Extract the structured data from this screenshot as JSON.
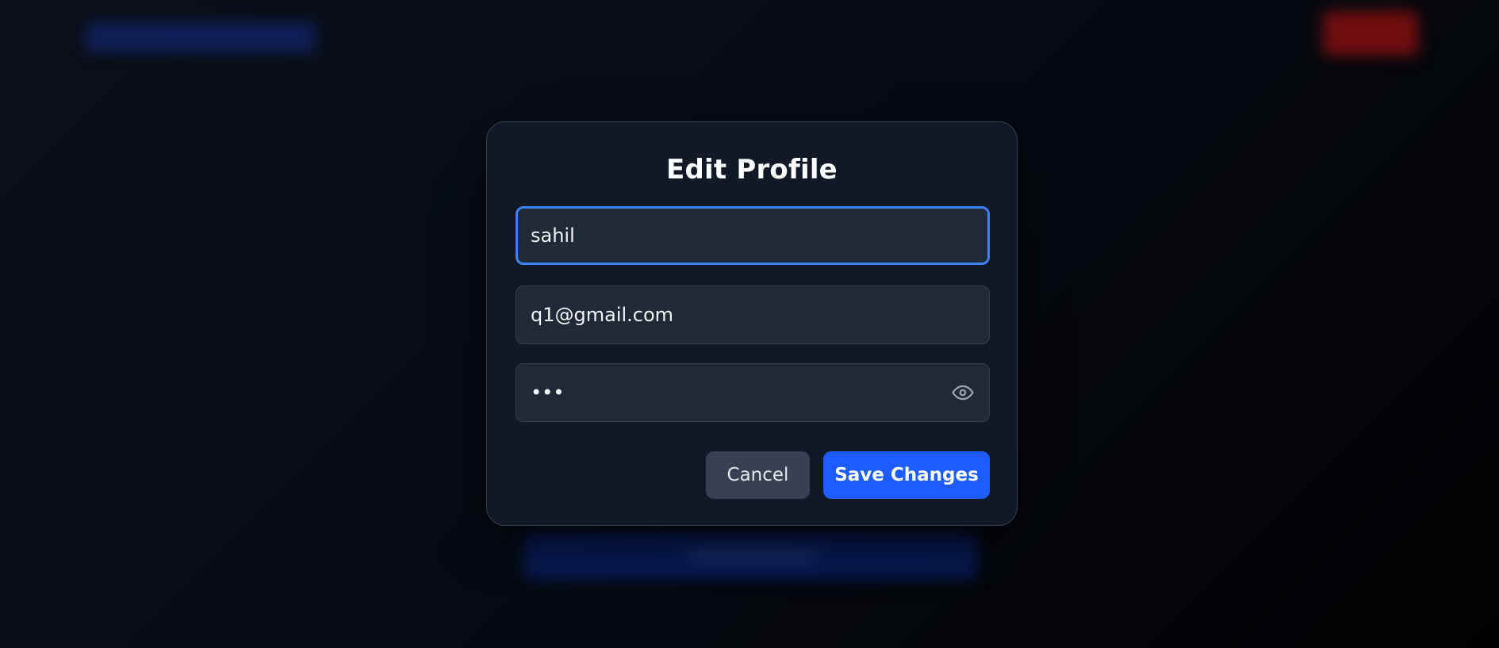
{
  "modal": {
    "title": "Edit Profile",
    "name_value": "sahil",
    "email_value": "q1@gmail.com",
    "password_value": "abc",
    "cancel_label": "Cancel",
    "save_label": "Save Changes"
  },
  "icons": {
    "password_toggle": "eye-icon"
  },
  "colors": {
    "accent": "#1d5cff",
    "focus_ring": "#3b82f6",
    "background_button": "#0b2a8a",
    "logout_button": "#c2161b"
  }
}
